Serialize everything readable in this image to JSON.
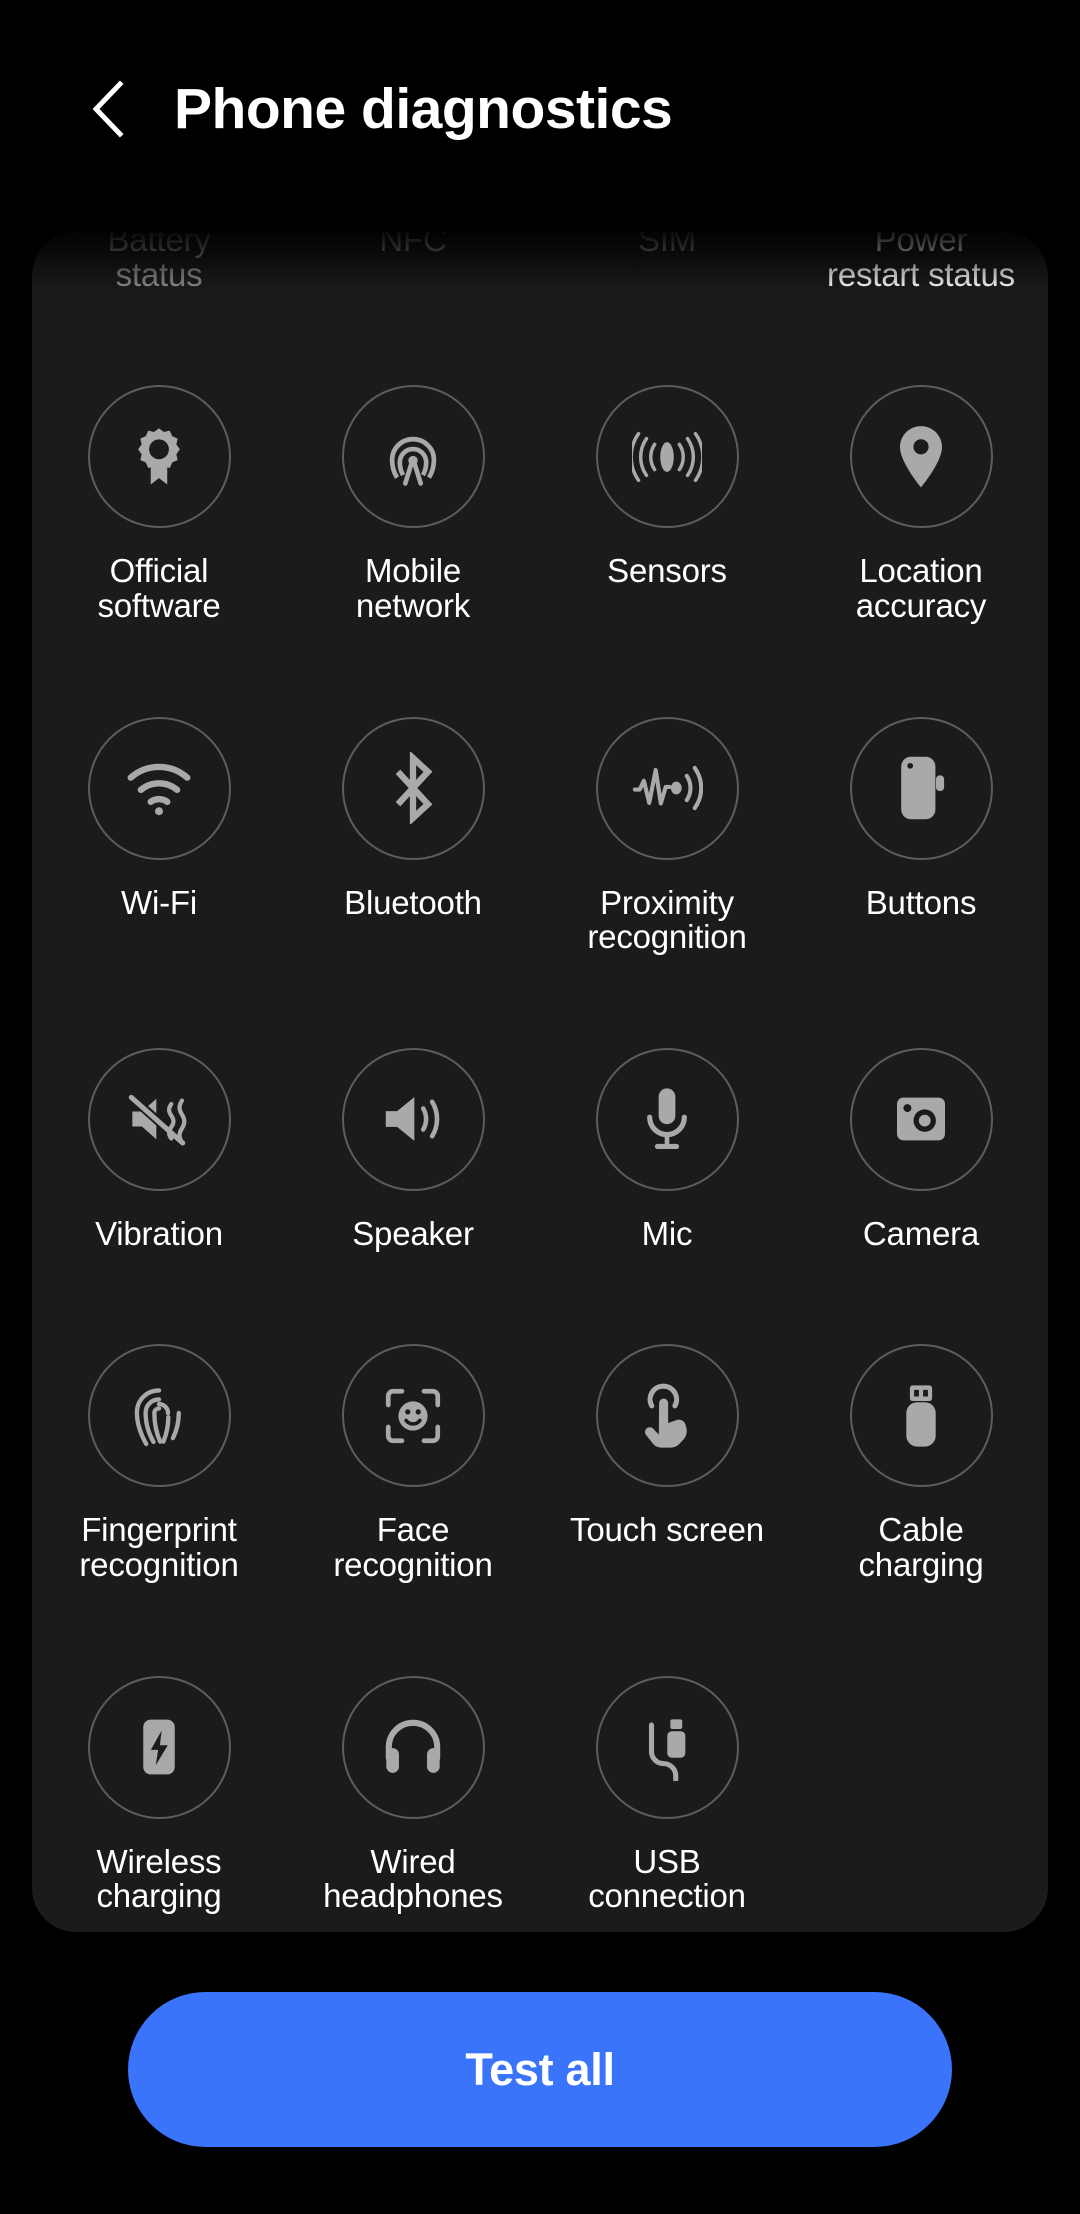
{
  "header": {
    "title": "Phone diagnostics",
    "back_icon": "chevron-left-icon"
  },
  "colors": {
    "page_background": "#000000",
    "card_background": "#1b1b1b",
    "circle_border": "#5d5d5d",
    "icon_fill": "#a9a9a9",
    "label_text": "#ffffff",
    "faded_label_text": "#8d8d8d",
    "accent_button": "#3a74fa"
  },
  "grid": {
    "partial_row": [
      {
        "label": "Battery\nstatus",
        "icon": "battery-status-icon",
        "faded": true
      },
      {
        "label": "NFC",
        "icon": "nfc-icon",
        "faded": true
      },
      {
        "label": "SIM",
        "icon": "sim-card-icon",
        "faded": true
      },
      {
        "label": "Power\nrestart status",
        "icon": "power-restart-icon",
        "faded": false
      }
    ],
    "rows": [
      [
        {
          "label": "Official\nsoftware",
          "icon": "badge-ribbon-icon"
        },
        {
          "label": "Mobile\nnetwork",
          "icon": "antenna-tower-icon"
        },
        {
          "label": "Sensors",
          "icon": "sensors-icon"
        },
        {
          "label": "Location\naccuracy",
          "icon": "location-pin-icon"
        }
      ],
      [
        {
          "label": "Wi-Fi",
          "icon": "wifi-icon"
        },
        {
          "label": "Bluetooth",
          "icon": "bluetooth-icon"
        },
        {
          "label": "Proximity\nrecognition",
          "icon": "proximity-waveform-icon"
        },
        {
          "label": "Buttons",
          "icon": "side-button-icon"
        }
      ],
      [
        {
          "label": "Vibration",
          "icon": "vibration-mute-icon"
        },
        {
          "label": "Speaker",
          "icon": "speaker-icon"
        },
        {
          "label": "Mic",
          "icon": "microphone-icon"
        },
        {
          "label": "Camera",
          "icon": "camera-icon"
        }
      ],
      [
        {
          "label": "Fingerprint\nrecognition",
          "icon": "fingerprint-icon"
        },
        {
          "label": "Face\nrecognition",
          "icon": "face-recognition-icon"
        },
        {
          "label": "Touch screen",
          "icon": "touch-hand-icon"
        },
        {
          "label": "Cable\ncharging",
          "icon": "usb-plug-icon"
        }
      ],
      [
        {
          "label": "Wireless\ncharging",
          "icon": "wireless-charging-icon"
        },
        {
          "label": "Wired\nheadphones",
          "icon": "headphones-icon"
        },
        {
          "label": "USB\nconnection",
          "icon": "usb-cable-icon"
        }
      ]
    ]
  },
  "footer": {
    "test_all_label": "Test all"
  }
}
